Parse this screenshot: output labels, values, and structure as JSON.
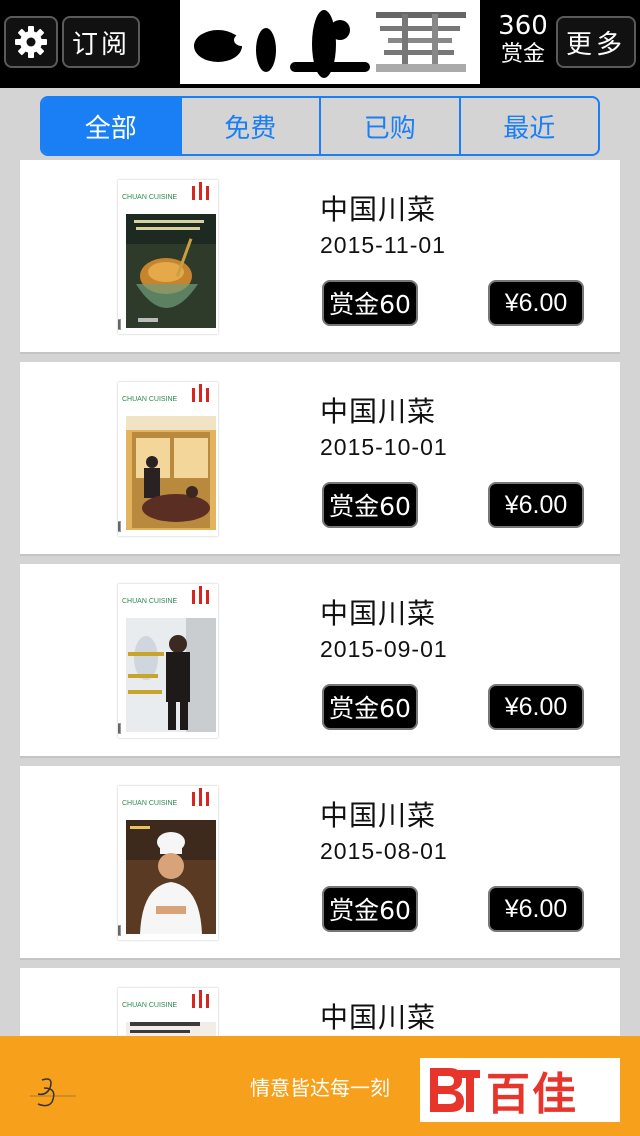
{
  "toolbar": {
    "subscribe_label": "订阅",
    "more_label": "更多",
    "reward_total": "360",
    "reward_label": "赏金"
  },
  "tabs": [
    {
      "label": "全部",
      "active": true
    },
    {
      "label": "免费",
      "active": false
    },
    {
      "label": "已购",
      "active": false
    },
    {
      "label": "最近",
      "active": false
    }
  ],
  "issues": [
    {
      "title": "中国川菜",
      "date": "2015-11-01",
      "reward": "赏金60",
      "price": "¥6.00"
    },
    {
      "title": "中国川菜",
      "date": "2015-10-01",
      "reward": "赏金60",
      "price": "¥6.00"
    },
    {
      "title": "中国川菜",
      "date": "2015-09-01",
      "reward": "赏金60",
      "price": "¥6.00"
    },
    {
      "title": "中国川菜",
      "date": "2015-08-01",
      "reward": "赏金60",
      "price": "¥6.00"
    },
    {
      "title": "中国川菜",
      "date": "",
      "reward": "",
      "price": ""
    }
  ],
  "cover_brand": "CHUAN CUISINE",
  "ad": {
    "slogan": "情意皆达每一刻",
    "logo_text": "百佳"
  },
  "colors": {
    "accent": "#1a7ef5",
    "ad_background": "#f6a01b",
    "ad_logo_red": "#e8352c"
  }
}
